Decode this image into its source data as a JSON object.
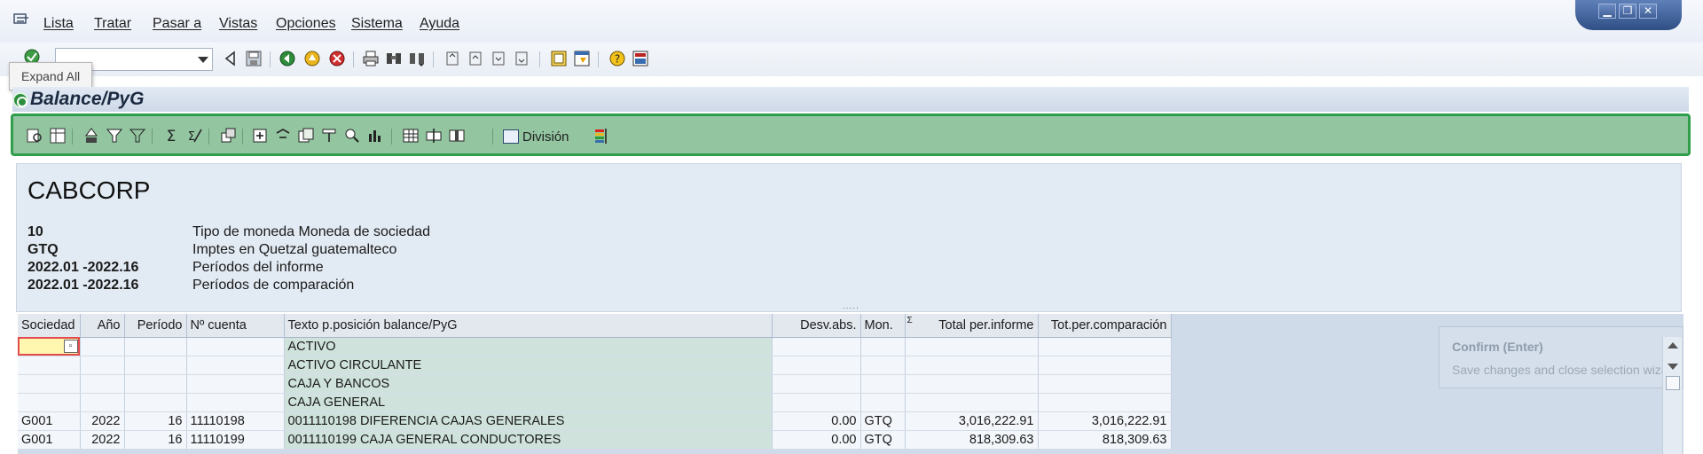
{
  "menu": {
    "items": [
      "Lista",
      "Tratar",
      "Pasar a",
      "Vistas",
      "Opciones",
      "Sistema",
      "Ayuda"
    ]
  },
  "toolbar": {
    "command_field_value": "",
    "tooltip": "Expand All"
  },
  "title": "Balance/PyG",
  "alv_toolbar": {
    "division_label": "División"
  },
  "header": {
    "company": "CABCORP",
    "rows": [
      {
        "key": "10",
        "value": "Tipo de moneda Moneda de sociedad"
      },
      {
        "key": "GTQ",
        "value": "Imptes en Quetzal guatemalteco"
      },
      {
        "key": "2022.01 -2022.16",
        "value": "Períodos del informe"
      },
      {
        "key": "2022.01 -2022.16",
        "value": "Períodos de comparación"
      }
    ],
    "splitter": "....."
  },
  "grid": {
    "columns": [
      "Sociedad",
      "Año",
      "Período",
      "Nº cuenta",
      "Texto p.posición balance/PyG",
      "Desv.abs.",
      "Mon.",
      "Σ",
      "Total per.informe",
      "Tot.per.comparación"
    ],
    "rows": [
      {
        "sociedad": "",
        "anio": "",
        "periodo": "",
        "cuenta": "",
        "texto": "ACTIVO",
        "desv": "",
        "mon": "",
        "total": "",
        "comp": ""
      },
      {
        "sociedad": "",
        "anio": "",
        "periodo": "",
        "cuenta": "",
        "texto": "ACTIVO CIRCULANTE",
        "desv": "",
        "mon": "",
        "total": "",
        "comp": ""
      },
      {
        "sociedad": "",
        "anio": "",
        "periodo": "",
        "cuenta": "",
        "texto": "CAJA Y BANCOS",
        "desv": "",
        "mon": "",
        "total": "",
        "comp": ""
      },
      {
        "sociedad": "",
        "anio": "",
        "periodo": "",
        "cuenta": "",
        "texto": "CAJA GENERAL",
        "desv": "",
        "mon": "",
        "total": "",
        "comp": ""
      },
      {
        "sociedad": "G001",
        "anio": "2022",
        "periodo": "16",
        "cuenta": "11110198",
        "texto": "0011110198 DIFERENCIA CAJAS GENERALES",
        "desv": "0.00",
        "mon": "GTQ",
        "total": "3,016,222.91",
        "comp": "3,016,222.91"
      },
      {
        "sociedad": "G001",
        "anio": "2022",
        "periodo": "16",
        "cuenta": "11110199",
        "texto": "0011110199 CAJA GENERAL CONDUCTORES",
        "desv": "0.00",
        "mon": "GTQ",
        "total": "818,309.63",
        "comp": "818,309.63"
      }
    ]
  },
  "confirm": {
    "title": "Confirm (Enter)",
    "description": "Save changes and close selection wizard."
  },
  "colors": {
    "alv_toolbar_bg": "#93c5a0",
    "alv_toolbar_border": "#2e9e4a",
    "text_column_bg": "#cfe3dc",
    "selected_cell": "#fff6b0"
  }
}
